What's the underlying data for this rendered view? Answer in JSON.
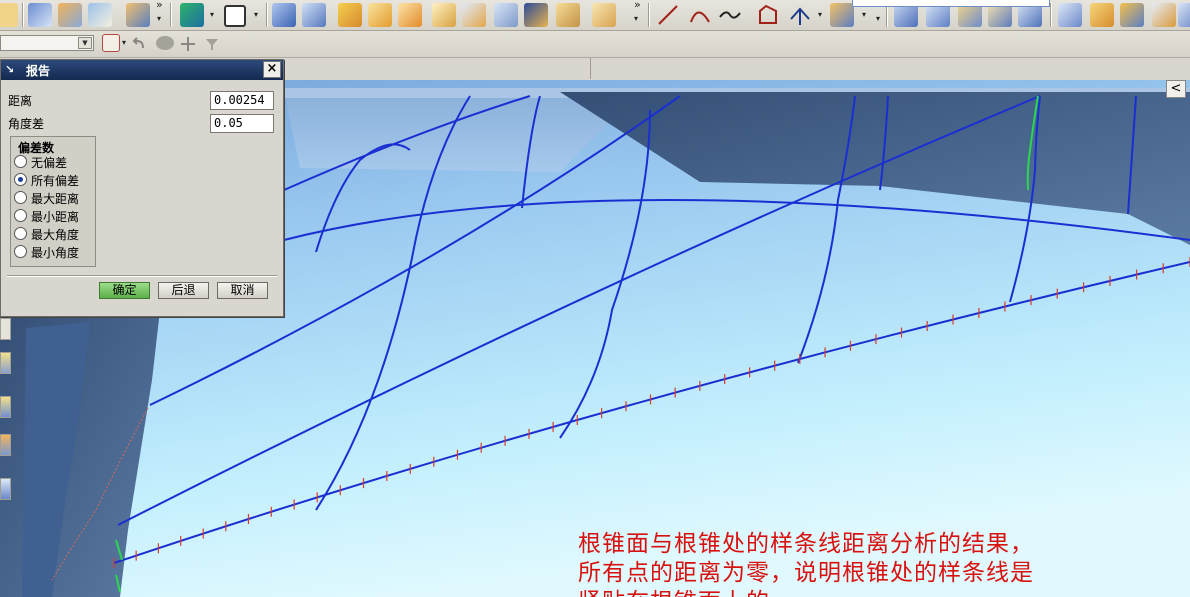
{
  "dialog": {
    "title": "报告",
    "close_label": "×",
    "distance_label": "距离",
    "distance_value": "0.00254",
    "angle_label": "角度差",
    "angle_value": "0.05",
    "group_title": "偏差数",
    "options": [
      {
        "label": "无偏差",
        "selected": false
      },
      {
        "label": "所有偏差",
        "selected": true
      },
      {
        "label": "最大距离",
        "selected": false
      },
      {
        "label": "最小距离",
        "selected": false
      },
      {
        "label": "最大角度",
        "selected": false
      },
      {
        "label": "最小角度",
        "selected": false
      }
    ],
    "buttons": {
      "ok": "确定",
      "back": "后退",
      "cancel": "取消"
    }
  },
  "viewport": {
    "collapse_icon": "chevron-left-icon",
    "collapse_glyph": "<",
    "annotation_lines": [
      "根锥面与根锥处的样条线距离分析的结果，",
      "所有点的距离为零，说明根锥处的样条线是",
      "紧贴在根锥面上的。"
    ]
  },
  "colors": {
    "curve": "#1a2fd1",
    "tick": "#d93a2a",
    "annotation": "#d8120e",
    "surface_light": "#bfe9ff",
    "surface_dark": "#3f5f86",
    "titlebar": "#13294f"
  }
}
